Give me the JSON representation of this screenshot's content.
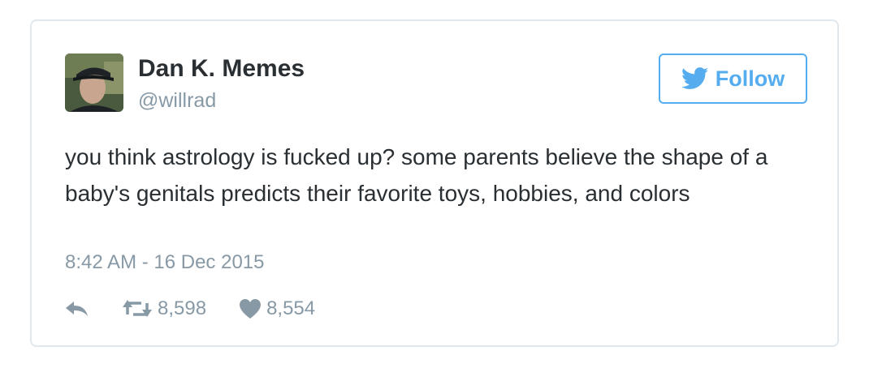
{
  "tweet": {
    "display_name": "Dan K. Memes",
    "handle": "@willrad",
    "follow_label": "Follow",
    "text": "you think astrology is fucked up? some parents believe the shape of a baby's genitals predicts their favorite toys, hobbies, and colors",
    "timestamp": "8:42 AM - 16 Dec 2015",
    "retweet_count": "8,598",
    "like_count": "8,554"
  },
  "icons": {
    "follow": "twitter-bird-icon",
    "reply": "reply-icon",
    "retweet": "retweet-icon",
    "like": "heart-icon"
  },
  "colors": {
    "accent": "#55acee",
    "text": "#292f33",
    "muted": "#8899a6",
    "border": "#e1e8ed"
  }
}
